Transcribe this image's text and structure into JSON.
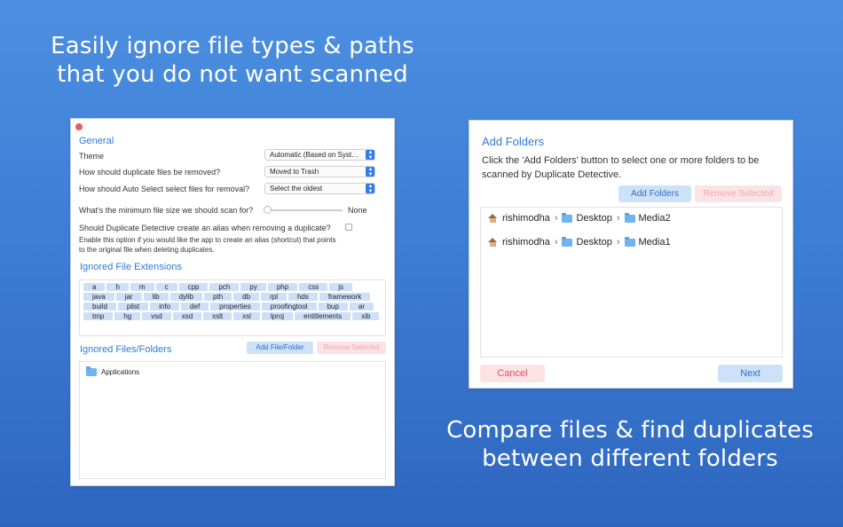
{
  "headlines": {
    "top_line1": "Easily ignore file types & paths",
    "top_line2": "that you do not want scanned",
    "bottom_line1": "Compare files & find duplicates",
    "bottom_line2": "between different folders"
  },
  "settings": {
    "general_title": "General",
    "theme_label": "Theme",
    "theme_value": "Automatic (Based on Syst…",
    "removal_label": "How should duplicate files be removed?",
    "removal_value": "Moved to Trash",
    "autoselect_label": "How should Auto Select select files for removal?",
    "autoselect_value": "Select the oldest",
    "minsize_label": "What's the minimum file size we should scan for?",
    "minsize_value": "None",
    "minsize_level": 0,
    "alias_label": "Should Duplicate Detective create an alias when removing a duplicate?",
    "alias_checked": false,
    "alias_help_line1": "Enable this option if you would like the app to create an alias (shortcut) that points",
    "alias_help_line2": "to the original file when deleting duplicates.",
    "extensions_title": "Ignored File Extensions",
    "extensions": [
      "a",
      "h",
      "m",
      "c",
      "cpp",
      "pch",
      "py",
      "php",
      "css",
      "js",
      "java",
      "jar",
      "lib",
      "dylib",
      "pth",
      "db",
      "rpl",
      "hds",
      "framework",
      "build",
      "plist",
      "info",
      "def",
      "properties",
      "proofingtool",
      "bup",
      "ar",
      "tmp",
      "hg",
      "vsd",
      "xsd",
      "xslt",
      "xsl",
      "lproj",
      "entitlements",
      "xib"
    ],
    "ignored_title": "Ignored Files/Folders",
    "add_file_folder_label": "Add File/Folder",
    "remove_selected_label": "Remove Selected",
    "ignored_items": [
      "Applications"
    ]
  },
  "add_folders": {
    "title": "Add Folders",
    "description_line1": "Click the 'Add Folders' button to select one or more folders to be",
    "description_line2": "scanned by Duplicate Detective.",
    "add_folders_label": "Add Folders",
    "remove_selected_label": "Remove Selected",
    "paths": [
      {
        "user": "rishimodha",
        "folder1": "Desktop",
        "folder2": "Media2"
      },
      {
        "user": "rishimodha",
        "folder1": "Desktop",
        "folder2": "Media1"
      }
    ],
    "separator": "›",
    "cancel_label": "Cancel",
    "next_label": "Next"
  },
  "colors": {
    "accent": "#2f7bd6",
    "button_blue_bg": "#cde2f9",
    "button_pink_bg": "#fbe3e5",
    "background_top": "#4c8fdf",
    "background_bottom": "#2e66bf"
  }
}
